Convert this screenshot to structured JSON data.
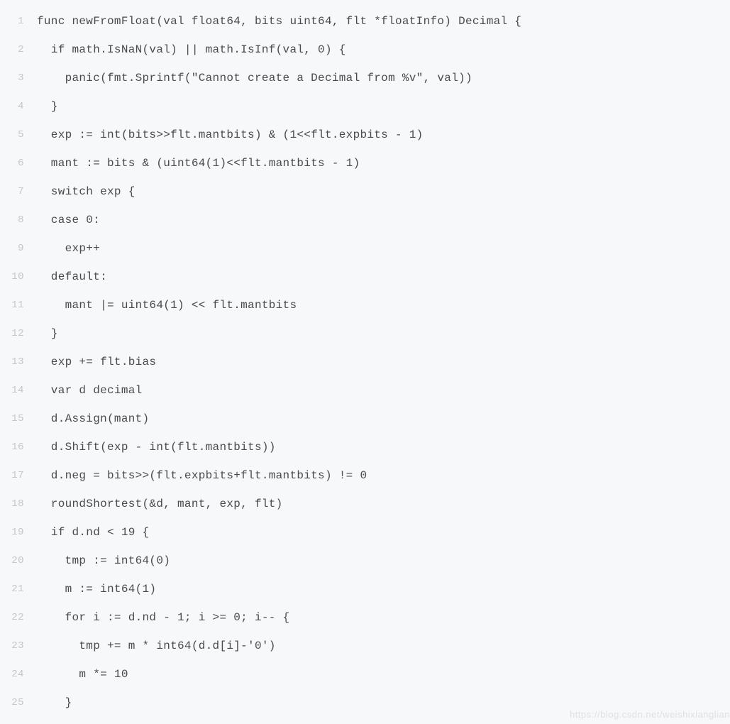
{
  "lines": [
    {
      "n": "1",
      "code": "func newFromFloat(val float64, bits uint64, flt *floatInfo) Decimal {"
    },
    {
      "n": "2",
      "code": "  if math.IsNaN(val) || math.IsInf(val, 0) {"
    },
    {
      "n": "3",
      "code": "    panic(fmt.Sprintf(\"Cannot create a Decimal from %v\", val))"
    },
    {
      "n": "4",
      "code": "  }"
    },
    {
      "n": "5",
      "code": "  exp := int(bits>>flt.mantbits) & (1<<flt.expbits - 1)"
    },
    {
      "n": "6",
      "code": "  mant := bits & (uint64(1)<<flt.mantbits - 1)"
    },
    {
      "n": "7",
      "code": "  switch exp {"
    },
    {
      "n": "8",
      "code": "  case 0:"
    },
    {
      "n": "9",
      "code": "    exp++"
    },
    {
      "n": "10",
      "code": "  default:"
    },
    {
      "n": "11",
      "code": "    mant |= uint64(1) << flt.mantbits"
    },
    {
      "n": "12",
      "code": "  }"
    },
    {
      "n": "13",
      "code": "  exp += flt.bias"
    },
    {
      "n": "14",
      "code": "  var d decimal"
    },
    {
      "n": "15",
      "code": "  d.Assign(mant)"
    },
    {
      "n": "16",
      "code": "  d.Shift(exp - int(flt.mantbits))"
    },
    {
      "n": "17",
      "code": "  d.neg = bits>>(flt.expbits+flt.mantbits) != 0"
    },
    {
      "n": "18",
      "code": "  roundShortest(&d, mant, exp, flt)"
    },
    {
      "n": "19",
      "code": "  if d.nd < 19 {"
    },
    {
      "n": "20",
      "code": "    tmp := int64(0)"
    },
    {
      "n": "21",
      "code": "    m := int64(1)"
    },
    {
      "n": "22",
      "code": "    for i := d.nd - 1; i >= 0; i-- {"
    },
    {
      "n": "23",
      "code": "      tmp += m * int64(d.d[i]-'0')"
    },
    {
      "n": "24",
      "code": "      m *= 10"
    },
    {
      "n": "25",
      "code": "    }"
    }
  ],
  "watermark": "https://blog.csdn.net/weishixianglian"
}
